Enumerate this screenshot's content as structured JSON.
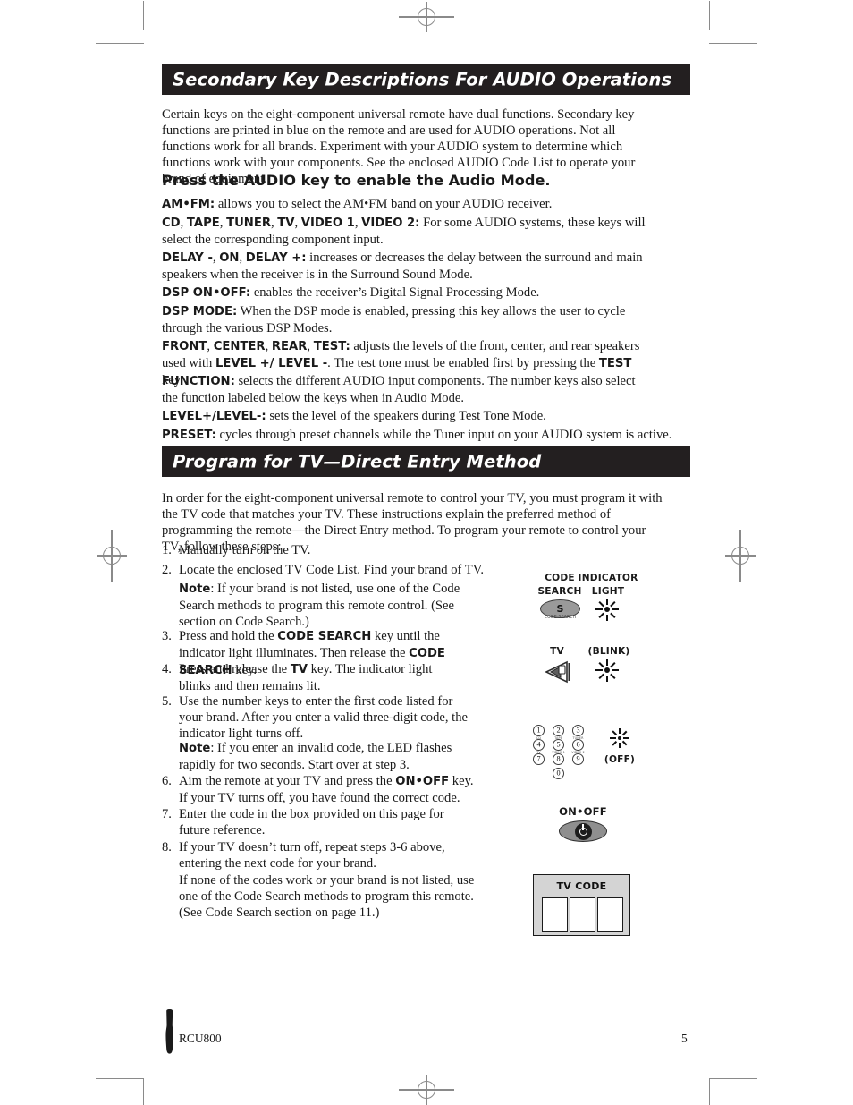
{
  "document": {
    "footer_model": "RCU800",
    "page_number": "5"
  },
  "sections": [
    {
      "id": "audio",
      "heading": "Secondary Key Descriptions For AUDIO Operations",
      "intro": "Certain keys on the eight-component universal remote have dual functions. Secondary key functions are printed in blue on the remote and are used for AUDIO operations. Not all functions work for all brands. Experiment with your AUDIO system to determine which functions work with your components. See the enclosed AUDIO Code List to operate your brand of equipment.",
      "subheading": "Press the AUDIO key to enable the Audio Mode."
    },
    {
      "id": "program_tv",
      "heading": "Program for TV—Direct Entry Method",
      "intro": "In order for the eight-component universal remote to control your TV, you must program it with the TV code that matches your TV. These instructions explain the preferred method of programming the remote—the Direct Entry method. To program your remote to control your TV, follow these steps:"
    }
  ],
  "key_descriptions": [
    {
      "keys": "AM•FM:",
      "text": " allows you to select the AM•FM band on your AUDIO receiver."
    },
    {
      "keys": "CD",
      "text": ", TAPE, TUNER, TV, VIDEO 1, VIDEO 2: For some AUDIO systems, these keys will select the corresponding component input."
    },
    {
      "keys": "DELAY -",
      "text": ", ON, DELAY +: increases or decreases the delay between the surround and main speakers when the receiver is in the Surround Sound Mode."
    },
    {
      "keys": "DSP ON•OFF:",
      "text": " enables the receiver’s Digital Signal Processing Mode."
    },
    {
      "keys": "DSP MODE:",
      "text": " When the DSP mode is enabled, pressing this key allows the user to cycle through the various DSP Modes."
    },
    {
      "keys": "FRONT",
      "text": ", CENTER, REAR, TEST: adjusts the levels of the front, center, and rear speakers used with LEVEL +/ LEVEL -. The test tone must be enabled first by pressing the TEST key."
    },
    {
      "keys": "FUNCTION:",
      "text": " selects the different AUDIO input components. The number keys also select the function labeled below the keys when in Audio Mode."
    },
    {
      "keys": "LEVEL+/LEVEL-:",
      "text": " sets the level of the speakers during Test Tone Mode."
    },
    {
      "keys": "PRESET:",
      "text": " cycles through preset channels while the Tuner input on your AUDIO system is active."
    }
  ],
  "key_desc_html": {
    "d1_bold": "AM•FM:",
    "d1_rest": " allows you to select the AM•FM band on your AUDIO receiver.",
    "d2_bold_a": "CD",
    "d2_mid_a": ", ",
    "d2_bold_b": "TAPE",
    "d2_mid_b": ", ",
    "d2_bold_c": "TUNER",
    "d2_mid_c": ", ",
    "d2_bold_d": "TV",
    "d2_mid_d": ", ",
    "d2_bold_e": "VIDEO 1",
    "d2_mid_e": ", ",
    "d2_bold_f": "VIDEO 2:",
    "d2_rest": " For some AUDIO systems, these keys will select the corresponding component input.",
    "d3_bold_a": "DELAY -",
    "d3_mid_a": ", ",
    "d3_bold_b": "ON",
    "d3_mid_b": ", ",
    "d3_bold_c": "DELAY +:",
    "d3_rest": " increases or decreases the delay between the surround and main speakers when the receiver is in the Surround Sound Mode.",
    "d4_bold": "DSP ON•OFF:",
    "d4_rest": " enables the receiver’s Digital Signal Processing Mode.",
    "d5_bold": "DSP MODE:",
    "d5_rest": " When the DSP mode is enabled, pressing this key allows the user to cycle through the various DSP Modes.",
    "d6_bold_a": "FRONT",
    "d6_mid_a": ", ",
    "d6_bold_b": "CENTER",
    "d6_mid_b": ", ",
    "d6_bold_c": "REAR",
    "d6_mid_c": ", ",
    "d6_bold_d": "TEST:",
    "d6_rest_a": " adjusts the levels of the front, center, and rear speakers used with ",
    "d6_bold_e": "LEVEL +/ LEVEL -",
    "d6_rest_b": ". The test tone must be enabled first by pressing the ",
    "d6_bold_f": "TEST",
    "d6_rest_c": " key.",
    "d7_bold": "FUNCTION:",
    "d7_rest": " selects the different AUDIO input components. The number keys also select the function labeled below the keys when in Audio Mode.",
    "d8_bold": "LEVEL+/LEVEL-:",
    "d8_rest": " sets the level of the speakers during Test Tone Mode.",
    "d9_bold": "PRESET:",
    "d9_rest": " cycles through preset channels while the Tuner input on your AUDIO system is active."
  },
  "steps": [
    {
      "num": "1.",
      "text": "Manually turn on the TV."
    },
    {
      "num": "2.",
      "text": "Locate the enclosed TV Code List. Find your brand of TV."
    },
    {
      "num": "3.",
      "text": "Press and hold the CODE SEARCH key until the indicator light illuminates. Then release the CODE SEARCH key."
    },
    {
      "num": "4.",
      "text": "Press and release the TV key. The indicator light blinks and then remains lit."
    },
    {
      "num": "5.",
      "text": "Use the number keys to enter the first code listed for your brand. After you enter a valid three-digit code, the indicator light turns off."
    },
    {
      "num": "6.",
      "text": "Aim the remote at your TV and press the ON•OFF key. If your TV turns off, you have found the correct code."
    },
    {
      "num": "7.",
      "text": "Enter the code in the box provided on this page for future reference."
    },
    {
      "num": "8.",
      "text": "If your TV doesn’t turn off, repeat steps 3-6 above, entering the next code for your brand."
    }
  ],
  "step_parts": {
    "s1": "Manually turn on the TV.",
    "s2": "Locate the enclosed TV Code List. Find your brand of TV.",
    "note1_label": "Note",
    "note1_text": ": If your brand is not listed, use one of the Code Search methods to program this remote control. (See section on Code Search.)",
    "s3_a": "Press and hold the ",
    "s3_b": "CODE SEARCH",
    "s3_c": " key until the indicator light illuminates. Then release the ",
    "s3_d": "CODE SEARCH",
    "s3_e": " key.",
    "s4_a": "Press and release the ",
    "s4_b": "TV",
    "s4_c": " key. The indicator light blinks and then remains lit.",
    "s5": "Use the number keys to enter the first code listed for your brand. After you enter a valid three-digit code, the indicator light turns off.",
    "note2_label": "Note",
    "note2_text": ": If you enter an invalid code, the LED flashes rapidly for two seconds. Start over at step 3.",
    "s6_a": "Aim the remote at your TV and press the ",
    "s6_b": "ON•OFF",
    "s6_c": " key. If your TV turns off, you have found the correct code.",
    "s7": "Enter the code in the box provided on this page for future reference.",
    "s8": "If your TV doesn’t turn off, repeat steps 3-6 above, entering the next code for your brand.",
    "s8_extra": "If none of the codes work or your brand is not listed, use one of the Code Search methods to program this remote. (See Code Search section on page 11.)"
  },
  "illustrations": {
    "code_search_label_line1": "CODE",
    "code_search_label_line2": "SEARCH",
    "indicator_label_line1": "INDICATOR",
    "indicator_label_line2": "LIGHT",
    "code_search_key_glyph": "S",
    "code_search_key_micro": "CODE SEARCH",
    "tv_label": "TV",
    "blink_label": "(BLINK)",
    "off_label": "(OFF)",
    "onoff_label": "ON•OFF",
    "tv_code_title": "TV CODE",
    "numpad_keys": [
      {
        "digit": "1",
        "sub": "CD"
      },
      {
        "digit": "2",
        "sub": "TAPE"
      },
      {
        "digit": "3",
        "sub": "TUNER"
      },
      {
        "digit": "4",
        "sub": "TV"
      },
      {
        "digit": "5",
        "sub": "VIDEO 1"
      },
      {
        "digit": "6",
        "sub": "VIDEO 2"
      },
      {
        "digit": "7",
        "sub": ""
      },
      {
        "digit": "8",
        "sub": ""
      },
      {
        "digit": "9",
        "sub": ""
      },
      {
        "digit": "0",
        "sub": ""
      }
    ]
  },
  "colors": {
    "band_background": "#231f20",
    "band_text": "#ffffff",
    "body_text": "#1a1a1a",
    "codebox_fill": "#d4d4d4",
    "key_fill": "#9a9a9a"
  }
}
